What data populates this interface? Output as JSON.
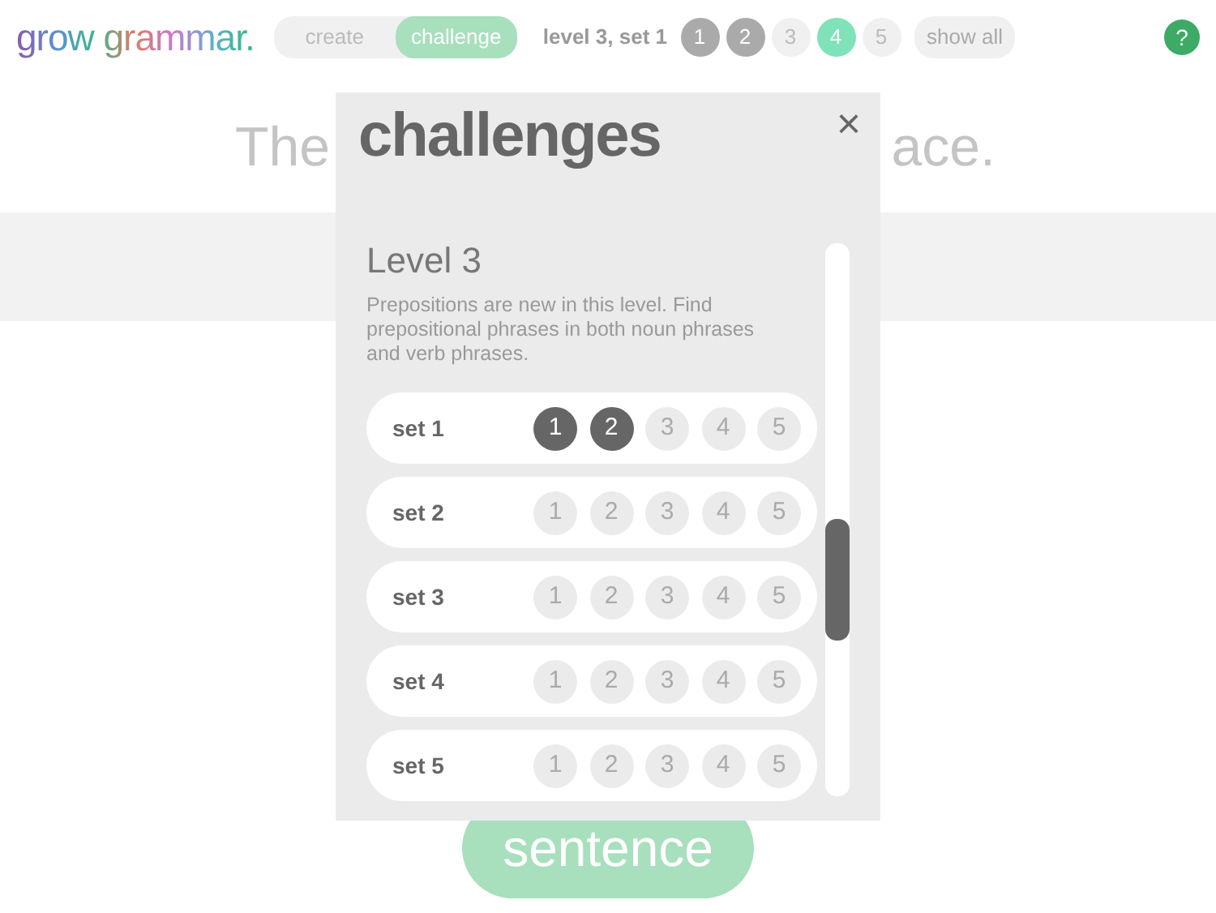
{
  "header": {
    "logo": "grow grammar.",
    "modes": [
      {
        "label": "create",
        "selected": false
      },
      {
        "label": "challenge",
        "selected": true
      }
    ],
    "progress_label": "level 3, set 1",
    "progress": [
      {
        "label": "1",
        "completed": true,
        "selected": false
      },
      {
        "label": "2",
        "completed": true,
        "selected": false
      },
      {
        "label": "3",
        "completed": false,
        "selected": false
      },
      {
        "label": "4",
        "completed": false,
        "selected": true
      },
      {
        "label": "5",
        "completed": false,
        "selected": false
      }
    ],
    "show_all": "show all",
    "help": "?"
  },
  "background": {
    "sentence_start": "The",
    "sentence_end": "ace.",
    "button": "sentence"
  },
  "dialog": {
    "title": "challenges",
    "close": "×",
    "level_title": "Level 3",
    "level_description": "Prepositions are new in this level. Find prepositional phrases in both noun phrases and verb phrases.",
    "sets": [
      {
        "name": "set 1",
        "challenges": [
          {
            "label": "1",
            "completed": true
          },
          {
            "label": "2",
            "completed": true
          },
          {
            "label": "3",
            "completed": false
          },
          {
            "label": "4",
            "completed": false
          },
          {
            "label": "5",
            "completed": false
          }
        ]
      },
      {
        "name": "set 2",
        "challenges": [
          {
            "label": "1",
            "completed": false
          },
          {
            "label": "2",
            "completed": false
          },
          {
            "label": "3",
            "completed": false
          },
          {
            "label": "4",
            "completed": false
          },
          {
            "label": "5",
            "completed": false
          }
        ]
      },
      {
        "name": "set 3",
        "challenges": [
          {
            "label": "1",
            "completed": false
          },
          {
            "label": "2",
            "completed": false
          },
          {
            "label": "3",
            "completed": false
          },
          {
            "label": "4",
            "completed": false
          },
          {
            "label": "5",
            "completed": false
          }
        ]
      },
      {
        "name": "set 4",
        "challenges": [
          {
            "label": "1",
            "completed": false
          },
          {
            "label": "2",
            "completed": false
          },
          {
            "label": "3",
            "completed": false
          },
          {
            "label": "4",
            "completed": false
          },
          {
            "label": "5",
            "completed": false
          }
        ]
      },
      {
        "name": "set 5",
        "challenges": [
          {
            "label": "1",
            "completed": false
          },
          {
            "label": "2",
            "completed": false
          },
          {
            "label": "3",
            "completed": false
          },
          {
            "label": "4",
            "completed": false
          },
          {
            "label": "5",
            "completed": false
          }
        ]
      }
    ]
  }
}
